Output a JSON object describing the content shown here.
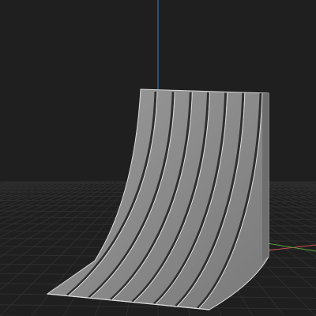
{
  "viewport": {
    "view": "perspective",
    "background_color": "#1f1f1f",
    "grid_color": "#2c2c2c",
    "axis_colors": {
      "x": "#c94c4c",
      "y": "#5a9a3a",
      "z": "#3d7fc4"
    }
  },
  "object": {
    "shape": "curved-ramp",
    "rib_count": 7,
    "surface_color": "#8c8c8c",
    "edge_color": "#dcdcdc",
    "groove_color": "#2e2e2e"
  }
}
